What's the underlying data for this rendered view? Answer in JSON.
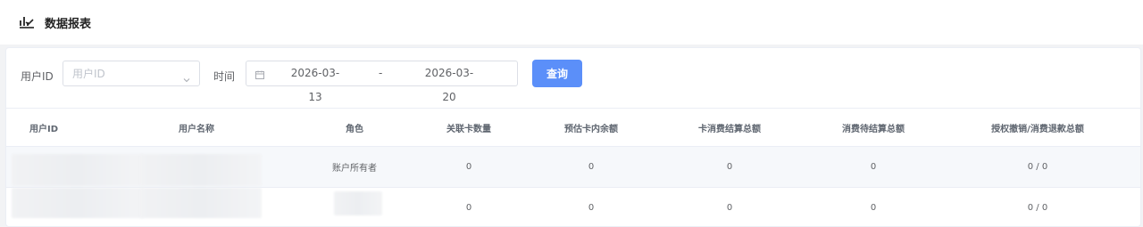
{
  "header": {
    "title": "数据报表",
    "icon": "chart-icon"
  },
  "filters": {
    "user_id_label": "用户ID",
    "user_id_placeholder": "用户ID",
    "time_label": "时间",
    "date_start": "2026-03-13",
    "date_separator": "-",
    "date_end": "2026-03-20",
    "query_button": "查询"
  },
  "colors": {
    "accent": "#5b8ff9",
    "row_stripe": "#f6f8fb",
    "border": "#ebeef5"
  },
  "table": {
    "columns": [
      "用户ID",
      "用户名称",
      "角色",
      "关联卡数量",
      "预估卡内余额",
      "卡消费结算总额",
      "消费待结算总额",
      "授权撤销/消费退款总额"
    ],
    "rows": [
      {
        "user_id": "",
        "user_name": "",
        "role": "账户所有者",
        "card_count": "0",
        "estimated_balance": "0",
        "settled_total": "0",
        "pending_total": "0",
        "refund_total": "0 / 0"
      },
      {
        "user_id": "",
        "user_name": "",
        "role": "",
        "card_count": "0",
        "estimated_balance": "0",
        "settled_total": "0",
        "pending_total": "0",
        "refund_total": "0 / 0"
      }
    ]
  }
}
